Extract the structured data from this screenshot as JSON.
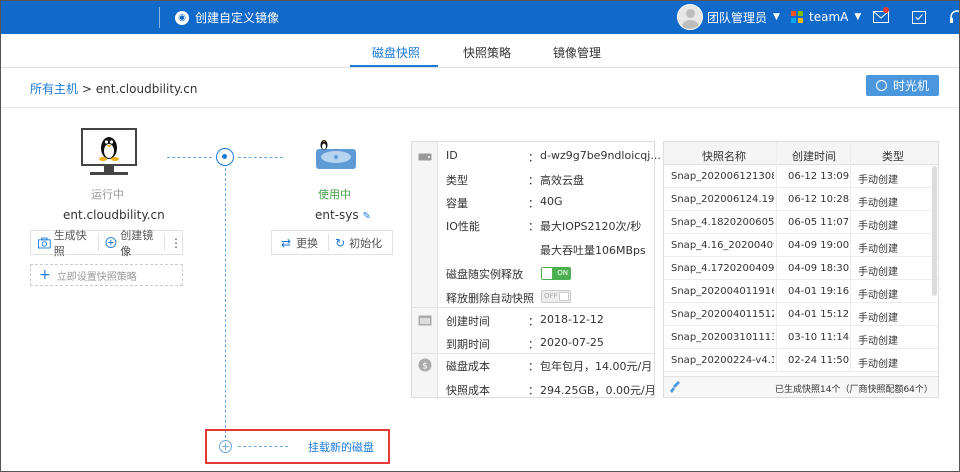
{
  "header": {
    "app_title": "创建自定义镜像",
    "user_name": "团队管理员",
    "team_name": "teamA"
  },
  "tabs": [
    {
      "label": "磁盘快照",
      "active": true
    },
    {
      "label": "快照策略",
      "active": false
    },
    {
      "label": "镜像管理",
      "active": false
    }
  ],
  "breadcrumb": {
    "root": "所有主机",
    "sep": " > ",
    "current": "ent.cloudbility.cn"
  },
  "time_machine_label": "时光机",
  "host": {
    "status": "运行中",
    "name": "ent.cloudbility.cn",
    "actions": {
      "snapshot": "生成快照",
      "image": "创建镜像",
      "more": "⋮"
    },
    "policy_label": "立即设置快照策略"
  },
  "disk": {
    "status": "使用中",
    "name": "ent-sys",
    "actions": {
      "replace": "更换",
      "init": "初始化"
    }
  },
  "attach_label": "挂载新的磁盘",
  "info": {
    "rows": [
      {
        "label": "ID",
        "value": "d-wz9g7be9ndloicqj..."
      },
      {
        "label": "类型",
        "value": "高效云盘"
      },
      {
        "label": "容量",
        "value": "40G"
      },
      {
        "label": "IO性能",
        "value": "最大IOPS2120次/秒"
      },
      {
        "label": "",
        "value": "最大吞吐量106MBps"
      }
    ],
    "toggles": [
      {
        "label": "磁盘随实例释放",
        "state": "ON"
      },
      {
        "label": "释放删除自动快照",
        "state": "OFF"
      }
    ],
    "dates": [
      {
        "label": "创建时间",
        "value": "2018-12-12"
      },
      {
        "label": "到期时间",
        "value": "2020-07-25"
      }
    ],
    "costs": [
      {
        "label": "磁盘成本",
        "value": "包年包月，14.00元/月"
      },
      {
        "label": "快照成本",
        "value": "294.25GB，0.00元/月"
      }
    ],
    "colon": "："
  },
  "snapshots": {
    "headers": [
      "快照名称",
      "创建时间",
      "类型"
    ],
    "rows": [
      [
        "Snap_20200612130​8",
        "06-12 13:09",
        "手动创建"
      ],
      [
        "Snap_20200612​4.191...",
        "06-12 10:28",
        "手动创建"
      ],
      [
        "Snap_4.18202006051...",
        "06-05 11:07",
        "手动创建"
      ],
      [
        "Snap_4.16_20200409...",
        "04-09 19:00",
        "手动创建"
      ],
      [
        "Snap_4.17202004091...",
        "04-09 18:30",
        "手动创建"
      ],
      [
        "Snap_20200401191​6...",
        "04-01 19:16",
        "手动创建"
      ],
      [
        "Snap_20200401151​2...",
        "04-01 15:12",
        "手动创建"
      ],
      [
        "Snap_20200310111​3...",
        "03-10 11:14",
        "手动创建"
      ],
      [
        "Snap_20200224-v4.15",
        "02-24 11:50",
        "手动创建"
      ]
    ],
    "footer": "已生成快照14个（厂商快照配额64个）"
  },
  "colors": {
    "topbar": "#1169c9",
    "accent": "#1a7ad9",
    "running": "#999999",
    "in_use": "#43a047",
    "highlight_border": "#e53935"
  }
}
